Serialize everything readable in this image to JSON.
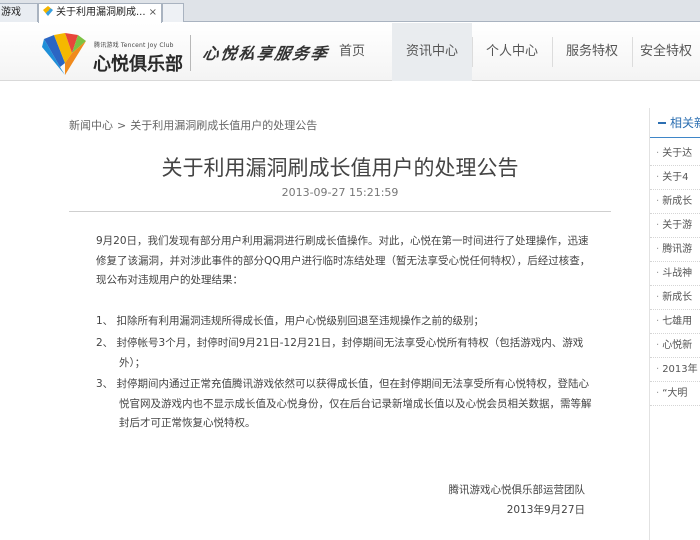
{
  "browser": {
    "tabs": [
      {
        "title": "游戏"
      },
      {
        "title": "关于利用漏洞刷成...",
        "close": "×"
      },
      {
        "title": ""
      }
    ]
  },
  "site": {
    "logo_small": "腾讯游戏 Tencent Joy Club",
    "logo_name": "心悦俱乐部",
    "slogan": "心悦私享服务季",
    "nav": [
      {
        "label": "首页",
        "active": false
      },
      {
        "label": "资讯中心",
        "active": true
      },
      {
        "label": "个人中心",
        "active": false
      },
      {
        "label": "服务特权",
        "active": false
      },
      {
        "label": "安全特权",
        "active": false
      }
    ]
  },
  "breadcrumb": {
    "root": "新闻中心",
    "separator": ">",
    "current": "关于利用漏洞刷成长值用户的处理公告"
  },
  "article": {
    "title": "关于利用漏洞刷成长值用户的处理公告",
    "date": "2013-09-27 15:21:59",
    "paragraphs": [
      "9月20日，我们发现有部分用户利用漏洞进行刷成长值操作。对此，心悦在第一时间进行了处理操作，迅速修复了该漏洞，并对涉此事件的部分QQ用户进行临时冻结处理（暂无法享受心悦任何特权），后经过核查，现公布对违规用户的处理结果：",
      "1、  扣除所有利用漏洞违规所得成长值，用户心悦级别回退至违规操作之前的级别；",
      "2、  封停帐号3个月，封停时间9月21日-12月21日，封停期间无法享受心悦所有特权（包括游戏内、游戏外）；",
      "3、  封停期间内通过正常充值腾讯游戏依然可以获得成长值，但在封停期间无法享受所有心悦特权，登陆心悦官网及游戏内也不显示成长值及心悦身份，仅在后台记录新增成长值以及心悦会员相关数据，需等解封后才可正常恢复心悦特权。"
    ],
    "signature": "腾讯游戏心悦俱乐部运营团队",
    "signature_date": "2013年9月27日"
  },
  "sidebar": {
    "heading": "相关新",
    "items": [
      "关于达",
      "关于4",
      "新成长",
      "关于游",
      "腾讯游",
      "斗战神",
      "新成长",
      "七雄用",
      "心悦新",
      "2013年",
      "“大明"
    ]
  },
  "colors": {
    "accent_blue": "#2c6fb2",
    "nav_active_bg": "#e9ecef",
    "text": "#444444"
  }
}
